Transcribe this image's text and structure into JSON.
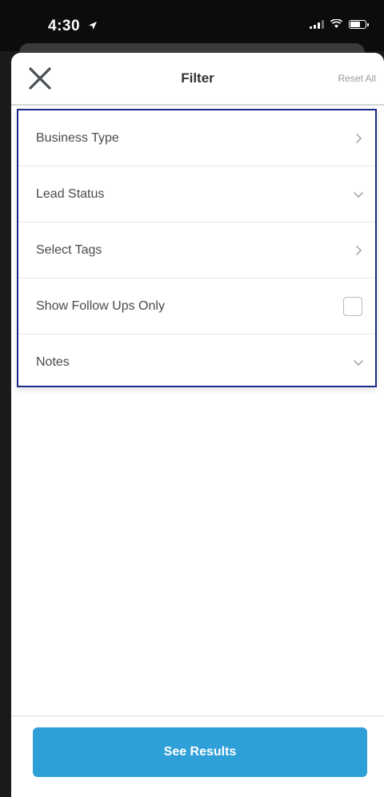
{
  "status_bar": {
    "time": "4:30",
    "icons": [
      "location-arrow-icon",
      "signal-icon",
      "wifi-icon",
      "battery-icon"
    ]
  },
  "header": {
    "title": "Filter",
    "close_icon": "close-icon",
    "reset_label": "Reset All"
  },
  "filters": [
    {
      "label": "Business Type",
      "control": "chevron-right-icon"
    },
    {
      "label": "Lead Status",
      "control": "chevron-down-icon"
    },
    {
      "label": "Select Tags",
      "control": "chevron-right-icon"
    },
    {
      "label": "Show Follow Ups Only",
      "control": "checkbox",
      "checked": false
    },
    {
      "label": "Notes",
      "control": "chevron-down-icon"
    }
  ],
  "footer": {
    "results_label": "See Results"
  },
  "colors": {
    "accent": "#2f9fd8",
    "highlight_border": "#1c2a8a",
    "text": "#4a4a4a",
    "muted": "#9a9a9a"
  }
}
